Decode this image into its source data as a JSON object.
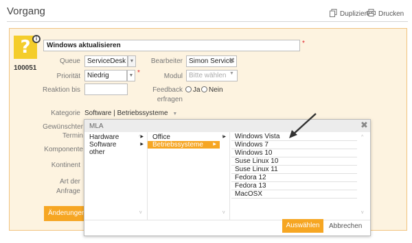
{
  "header": {
    "title": "Vorgang",
    "duplicate_label": "Duplizieren",
    "print_label": "Drucken"
  },
  "ticket": {
    "id": "100051",
    "title_value": "Windows aktualisieren"
  },
  "form": {
    "queue_label": "Queue",
    "queue_value": "ServiceDesk D",
    "assignee_label": "Bearbeiter",
    "assignee_value": "Simon Service",
    "priority_label": "Priorität",
    "priority_value": "Niedrig",
    "module_label": "Modul",
    "module_placeholder": "Bitte wählen",
    "reaction_label": "Reaktion bis",
    "feedback_label_1": "Feedback",
    "feedback_label_2": "erfragen",
    "feedback_yes": "Ja",
    "feedback_no": "Nein",
    "category_label": "Kategorie",
    "category_value": "Software | Betriebssysteme",
    "desired_date_label_1": "Gewünschter",
    "desired_date_label_2": "Termin",
    "component_label": "Komponente",
    "continent_label": "Kontinent",
    "request_type_label_1": "Art der",
    "request_type_label_2": "Anfrage",
    "changes_button": "Änderungen"
  },
  "dialog": {
    "title": "MLA",
    "col1": [
      {
        "label": "Hardware",
        "has_children": true,
        "selected": false
      },
      {
        "label": "Software",
        "has_children": true,
        "selected": false
      },
      {
        "label": "other",
        "has_children": false,
        "selected": false
      }
    ],
    "col2": [
      {
        "label": "Office",
        "has_children": true,
        "selected": false
      },
      {
        "label": "Betriebssysteme",
        "has_children": true,
        "selected": true
      }
    ],
    "col3": [
      "Windows Vista",
      "Windows 7",
      "Windows 10",
      "Suse Linux 10",
      "Suse Linux 11",
      "Fedora 12",
      "Fedora 13",
      "MacOSX"
    ],
    "select_button": "Auswählen",
    "cancel_button": "Abbrechen"
  },
  "colors": {
    "accent": "#f6a623",
    "panel_bg": "#fdf3e0",
    "panel_border": "#f1c27e",
    "required": "#e0222a"
  },
  "icons": {
    "duplicate": "duplicate-icon",
    "print": "print-icon",
    "ticket": "question-icon",
    "close": "close-icon"
  }
}
